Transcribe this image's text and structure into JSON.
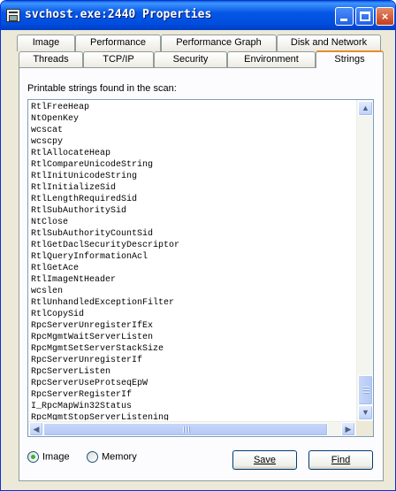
{
  "window": {
    "title": "svchost.exe:2440 Properties",
    "buttons": {
      "minimize": "_",
      "maximize": "□",
      "close": "×"
    }
  },
  "tabs": {
    "row_back": [
      "Image",
      "Performance",
      "Performance Graph",
      "Disk and Network"
    ],
    "row_front": [
      "Threads",
      "TCP/IP",
      "Security",
      "Environment",
      "Strings"
    ],
    "active": "Strings"
  },
  "strings_panel": {
    "label": "Printable strings found in the scan:",
    "items": [
      "RtlFreeHeap",
      "NtOpenKey",
      "wcscat",
      "wcscpy",
      "RtlAllocateHeap",
      "RtlCompareUnicodeString",
      "RtlInitUnicodeString",
      "RtlInitializeSid",
      "RtlLengthRequiredSid",
      "RtlSubAuthoritySid",
      "NtClose",
      "RtlSubAuthorityCountSid",
      "RtlGetDaclSecurityDescriptor",
      "RtlQueryInformationAcl",
      "RtlGetAce",
      "RtlImageNtHeader",
      "wcslen",
      "RtlUnhandledExceptionFilter",
      "RtlCopySid",
      "RpcServerUnregisterIfEx",
      "RpcMgmtWaitServerListen",
      "RpcMgmtSetServerStackSize",
      "RpcServerUnregisterIf",
      "RpcServerListen",
      "RpcServerUseProtseqEpW",
      "RpcServerRegisterIf",
      "I_RpcMapWin32Status",
      "RpcMgmtStopServerListening"
    ]
  },
  "scan_source": {
    "options": [
      "Image",
      "Memory"
    ],
    "selected": "Image"
  },
  "actions": {
    "save": "Save",
    "find": "Find"
  },
  "colors": {
    "title_bar": "#0054e3",
    "active_tab_accent": "#e68b2c",
    "panel": "#fcfcfe"
  }
}
